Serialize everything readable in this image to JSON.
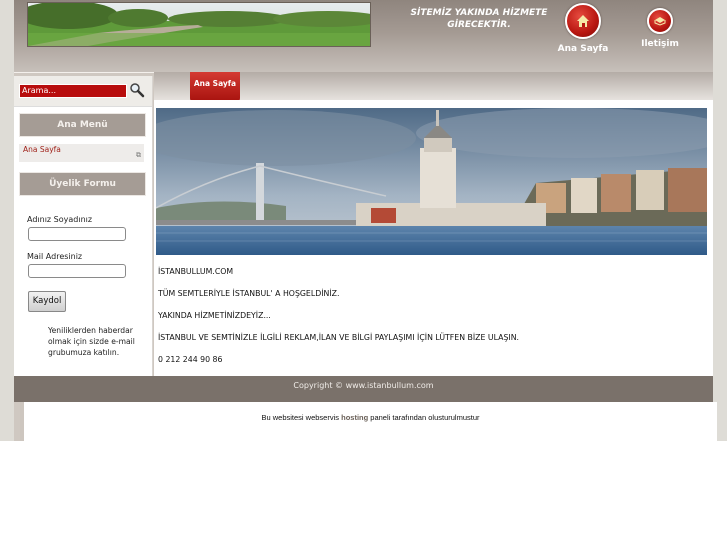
{
  "header": {
    "slogan_line1": "SİTEMİZ YAKINDA HİZMETE",
    "slogan_line2": "GİRECEKTİR.",
    "nav": [
      {
        "label": "Ana Sayfa",
        "icon": "home-icon"
      },
      {
        "label": "Iletişim",
        "icon": "mail-icon"
      }
    ]
  },
  "sidebar": {
    "search_placeholder": "Arama...",
    "main_menu_title": "Ana Menü",
    "menu_items": [
      {
        "label": "Ana Sayfa"
      }
    ],
    "form_title": "Üyelik Formu",
    "name_label": "Adınız Soyadınız",
    "email_label": "Mail Adresiniz",
    "register_label": "Kaydol",
    "newsletter_line1": "Yeniliklerden haberdar",
    "newsletter_line2": "olmak için sizde e-mail",
    "newsletter_line3": "grubumuza katılın."
  },
  "tabs": [
    {
      "label": "Ana Sayfa"
    }
  ],
  "content": {
    "site": "İSTANBULLUM.COM",
    "welcome": "TÜM SEMTLERİYLE İSTANBUL' A HOŞGELDİNİZ.",
    "soon": "YAKINDA HİZMETİNİZDEYİZ...",
    "contact": "İSTANBUL VE  SEMTİNİZLE İLGİLİ  REKLAM,İLAN VE BİLGİ PAYLAŞIMI İÇİN LÜTFEN BİZE ULAŞIN.",
    "phone": "0 212 244 90 86"
  },
  "footer": {
    "copyright": "Copyright © www.istanbullum.com",
    "credit_prefix": "Bu websitesi webservis ",
    "credit_link": "hosting",
    "credit_suffix": " paneli tarafından olusturulmustur"
  },
  "colors": {
    "accent_red": "#b80d0d",
    "header_brown": "#8f857e",
    "footer_brown": "#7a716a"
  }
}
